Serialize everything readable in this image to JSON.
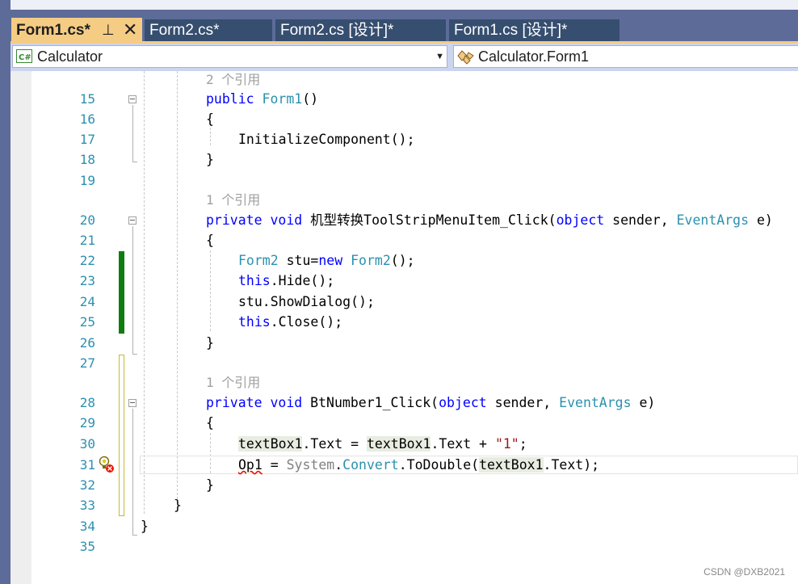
{
  "tabs": [
    {
      "label": "Form1.cs*",
      "active": true
    },
    {
      "label": "Form2.cs*",
      "active": false
    },
    {
      "label": "Form2.cs [设计]*",
      "active": false
    },
    {
      "label": "Form1.cs [设计]*",
      "active": false
    }
  ],
  "tab_pin_glyph": "ᅡ",
  "tab_close_glyph": "✕",
  "nav": {
    "project": "Calculator",
    "project_icon": "csharp-project-icon",
    "type": "Calculator.Form1",
    "type_icon": "class-icon"
  },
  "line_numbers": [
    "15",
    "16",
    "17",
    "18",
    "19",
    "20",
    "21",
    "22",
    "23",
    "24",
    "25",
    "26",
    "27",
    "28",
    "29",
    "30",
    "31",
    "32",
    "33",
    "34",
    "35"
  ],
  "refs": {
    "ctor": "2 个引用",
    "menu_click": "1 个引用",
    "bt_click": "1 个引用"
  },
  "code": {
    "l15_kw": "public",
    "l15_ty": "Form1",
    "l15_rest": "()",
    "open_brace": "{",
    "close_brace": "}",
    "l17": "InitializeComponent();",
    "l20_kw1": "private",
    "l20_kw2": "void",
    "l20_name": "机型转换ToolStripMenuItem_Click(",
    "l20_kw3": "object",
    "l20_mid": " sender, ",
    "l20_ty": "EventArgs",
    "l20_end": " e)",
    "l22_ty1": "Form2",
    "l22_mid": " stu=",
    "l22_kw": "new",
    "l22_ty2": "Form2",
    "l22_end": "();",
    "l23_kw": "this",
    "l23_end": ".Hide();",
    "l24": "stu.ShowDialog();",
    "l25_kw": "this",
    "l25_end": ".Close();",
    "l28_kw1": "private",
    "l28_kw2": "void",
    "l28_name": "BtNumber1_Click(",
    "l28_kw3": "object",
    "l28_mid": " sender, ",
    "l28_ty": "EventArgs",
    "l28_end": " e)",
    "l30_a": "textBox1",
    "l30_b": ".Text = ",
    "l30_c": "textBox1",
    "l30_d": ".Text + ",
    "l30_str": "\"1\"",
    "l30_end": ";",
    "l31_err": "Op1",
    "l31_eq": " = ",
    "l31_sys": "System",
    "l31_dot": ".",
    "l31_ty": "Convert",
    "l31_call": ".ToDouble(",
    "l31_arg": "textBox1",
    "l31_end": ".Text);"
  },
  "colors": {
    "keyword": "#0000ff",
    "type": "#2b91af",
    "string": "#a31515",
    "line_number": "#2b91af",
    "changed_saved": "#107c10",
    "changed_unsaved": "#c4bb2e",
    "tab_active": "#f5cc84"
  },
  "watermark": "CSDN @DXB2021"
}
